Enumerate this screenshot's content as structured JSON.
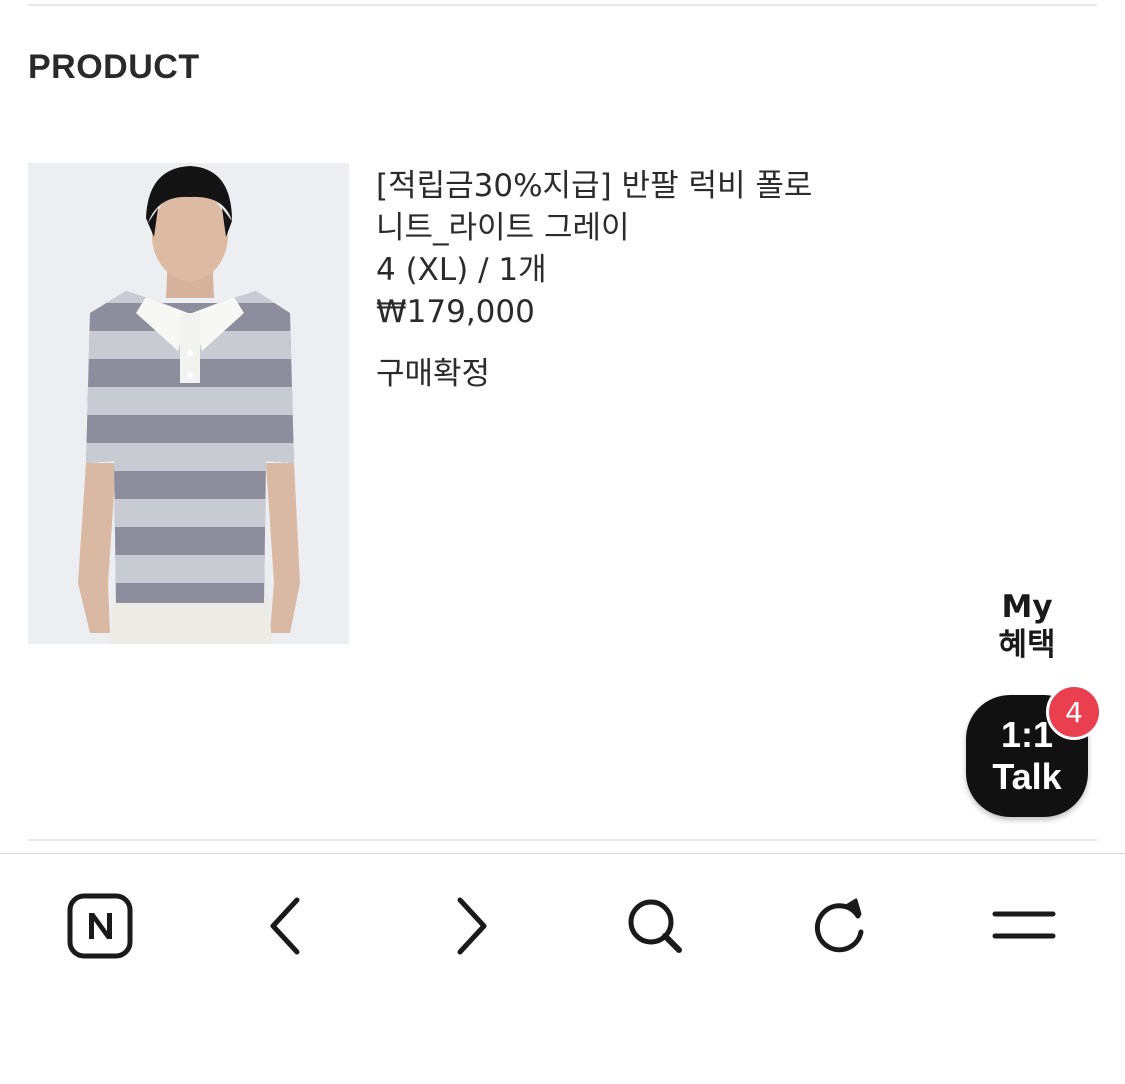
{
  "section": {
    "title": "PRODUCT"
  },
  "product": {
    "image_alt": "반팔 럭비 폴로 니트 라이트 그레이 모델 착용 이미지",
    "name_line1": "[적립금30%지급] 반팔 럭비 폴로",
    "name_line2": "니트_라이트 그레이",
    "option": "4 (XL) / 1개",
    "price": "₩179,000",
    "status": "구매확정"
  },
  "floating": {
    "benefit_line1": "My",
    "benefit_line2": "혜택",
    "talk_line1": "1:1",
    "talk_line2": "Talk",
    "talk_badge": "4",
    "badge_color": "#ea3f4e"
  },
  "browser_bar": {
    "items": [
      {
        "icon": "naver-n-icon"
      },
      {
        "icon": "chevron-left-icon"
      },
      {
        "icon": "chevron-right-icon"
      },
      {
        "icon": "search-icon"
      },
      {
        "icon": "refresh-icon"
      },
      {
        "icon": "menu-icon"
      }
    ]
  }
}
